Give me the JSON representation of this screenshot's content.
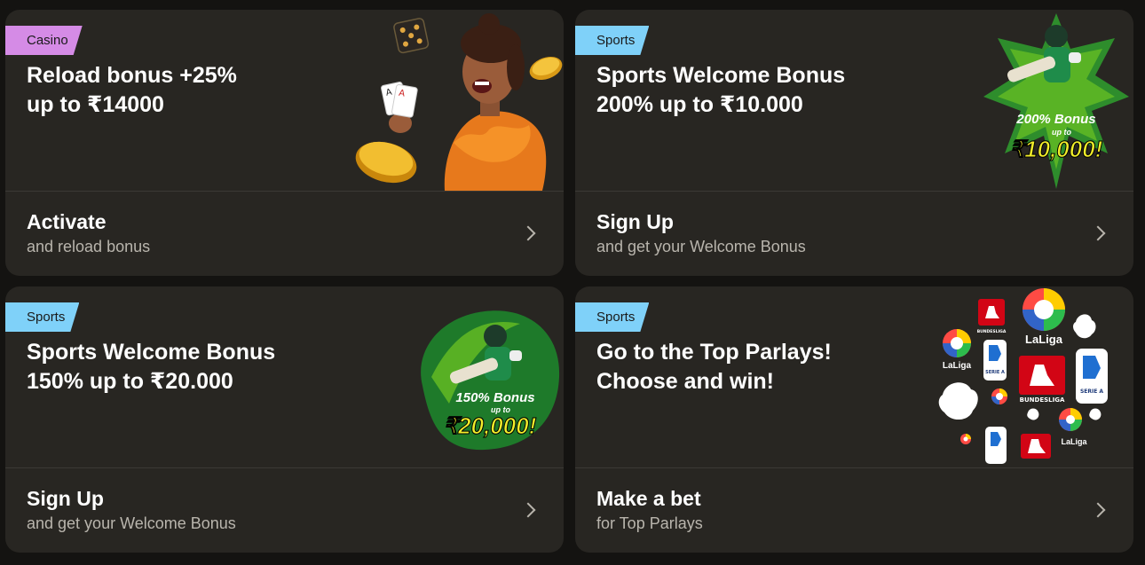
{
  "cards": [
    {
      "tag": "Casino",
      "title_line1": "Reload bonus +25%",
      "title_line2": "up to ₹14000",
      "action_title": "Activate",
      "action_sub": "and reload bonus"
    },
    {
      "tag": "Sports",
      "title_line1": "Sports Welcome Bonus",
      "title_line2": "200% up to ₹10.000",
      "action_title": "Sign Up",
      "action_sub": "and get your Welcome Bonus",
      "art": {
        "bonus_line": "200% Bonus",
        "up_to": "up to",
        "amount": "₹10,000!"
      }
    },
    {
      "tag": "Sports",
      "title_line1": "Sports Welcome Bonus",
      "title_line2": "150% up to ₹20.000",
      "action_title": "Sign Up",
      "action_sub": "and get your Welcome Bonus",
      "art": {
        "bonus_line": "150% Bonus",
        "up_to": "up to",
        "amount": "₹20,000!"
      }
    },
    {
      "tag": "Sports",
      "title_line1": "Go to the Top Parlays!",
      "title_line2": "Choose and win!",
      "action_title": "Make a bet",
      "action_sub": "for Top Parlays",
      "art": {
        "laliga": "LaLiga",
        "bundesliga": "BUNDESLIGA",
        "serie_a": "SERIE A"
      }
    }
  ],
  "colors": {
    "casino_tag": "#d58be6",
    "sports_tag": "#7fd1f9",
    "card_bg": "#282622",
    "page_bg": "#141311",
    "bonus_amount": "#f3ef2a",
    "bonus_green": "#2f9a2e"
  }
}
